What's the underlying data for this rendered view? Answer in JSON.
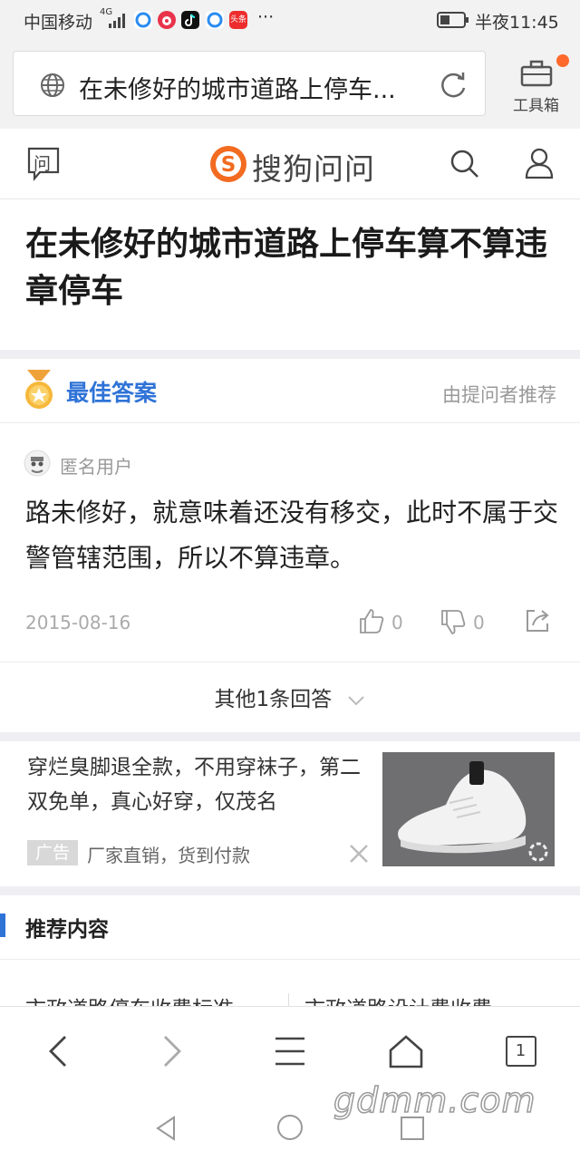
{
  "status_bar": {
    "carrier": "中国移动",
    "network": "4G",
    "notification_more": "···",
    "time": "半夜11:45",
    "app_icons": [
      "browser-app-icon",
      "weibo-app-icon",
      "tiktok-app-icon",
      "browser-app-icon",
      "toutiao-app-icon"
    ],
    "toutiao_label": "头条"
  },
  "browser": {
    "url_title": "在未修好的城市道路上停车...",
    "toolbox_label": "工具箱",
    "toolbox_badge_color": "#ff6a2c"
  },
  "site": {
    "ask_icon_label": "问",
    "logo_text": "搜狗问问",
    "brand_color": "#f26b21"
  },
  "question": {
    "title": "在未修好的城市道路上停车算不算违章停车"
  },
  "best_answer": {
    "label": "最佳答案",
    "recommended_by": "由提问者推荐",
    "user_name": "匿名用户",
    "text": "路未修好，就意味着还没有移交，此时不属于交警管辖范围，所以不算违章。",
    "date": "2015-08-16",
    "likes": "0",
    "dislikes": "0"
  },
  "more_answers": {
    "label": "其他1条回答"
  },
  "ad": {
    "title": "穿烂臭脚退全款，不用穿袜子，第二双免单，真心好穿，仅茂名",
    "badge": "广告",
    "source": "厂家直销，货到付款"
  },
  "recommend": {
    "title": "推荐内容",
    "items": [
      "市政道路停车收费标准",
      "市政道路设计费收费"
    ]
  },
  "toolbar": {
    "tab_count": "1"
  },
  "watermark": "gdmm.com",
  "colors": {
    "accent": "#2f73d7",
    "separator": "#efeff3"
  }
}
